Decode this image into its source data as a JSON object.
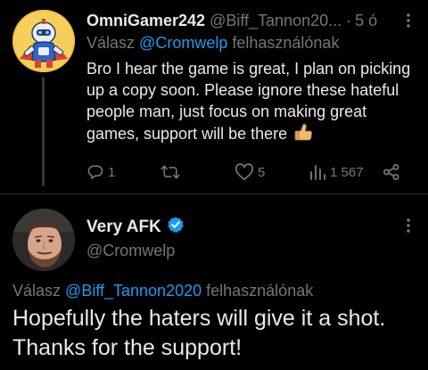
{
  "reply_tweet": {
    "display_name": "OmniGamer242",
    "handle": "@Biff_Tannon20...",
    "separator": "·",
    "time": "5 ó",
    "replying_prefix": "Válasz",
    "replying_to": "@Cromwelp",
    "replying_suffix": "felhasználónak",
    "text": "Bro I hear the game is great, I plan on picking up a copy soon. Please ignore these hateful people man, just focus on making great games, support will be there",
    "emoji": "thumbs-up",
    "actions": {
      "replies": "1",
      "retweets": "",
      "likes": "5",
      "views": "1 567"
    }
  },
  "main_tweet": {
    "display_name": "Very AFK",
    "verified": true,
    "handle": "@Cromwelp",
    "replying_prefix": "Válasz",
    "replying_to": "@Biff_Tannon2020",
    "replying_suffix": "felhasználónak",
    "text": "Hopefully the haters will give it a shot. Thanks for the support!"
  },
  "colors": {
    "background": "#000000",
    "text_primary": "#e7e9ea",
    "text_secondary": "#71767b",
    "accent": "#1d9bf0",
    "divider": "#2f3336"
  },
  "icons": [
    "reply-icon",
    "retweet-icon",
    "like-icon",
    "views-icon",
    "share-icon",
    "more-icon",
    "verified-badge-icon",
    "thumbs-up-emoji"
  ]
}
